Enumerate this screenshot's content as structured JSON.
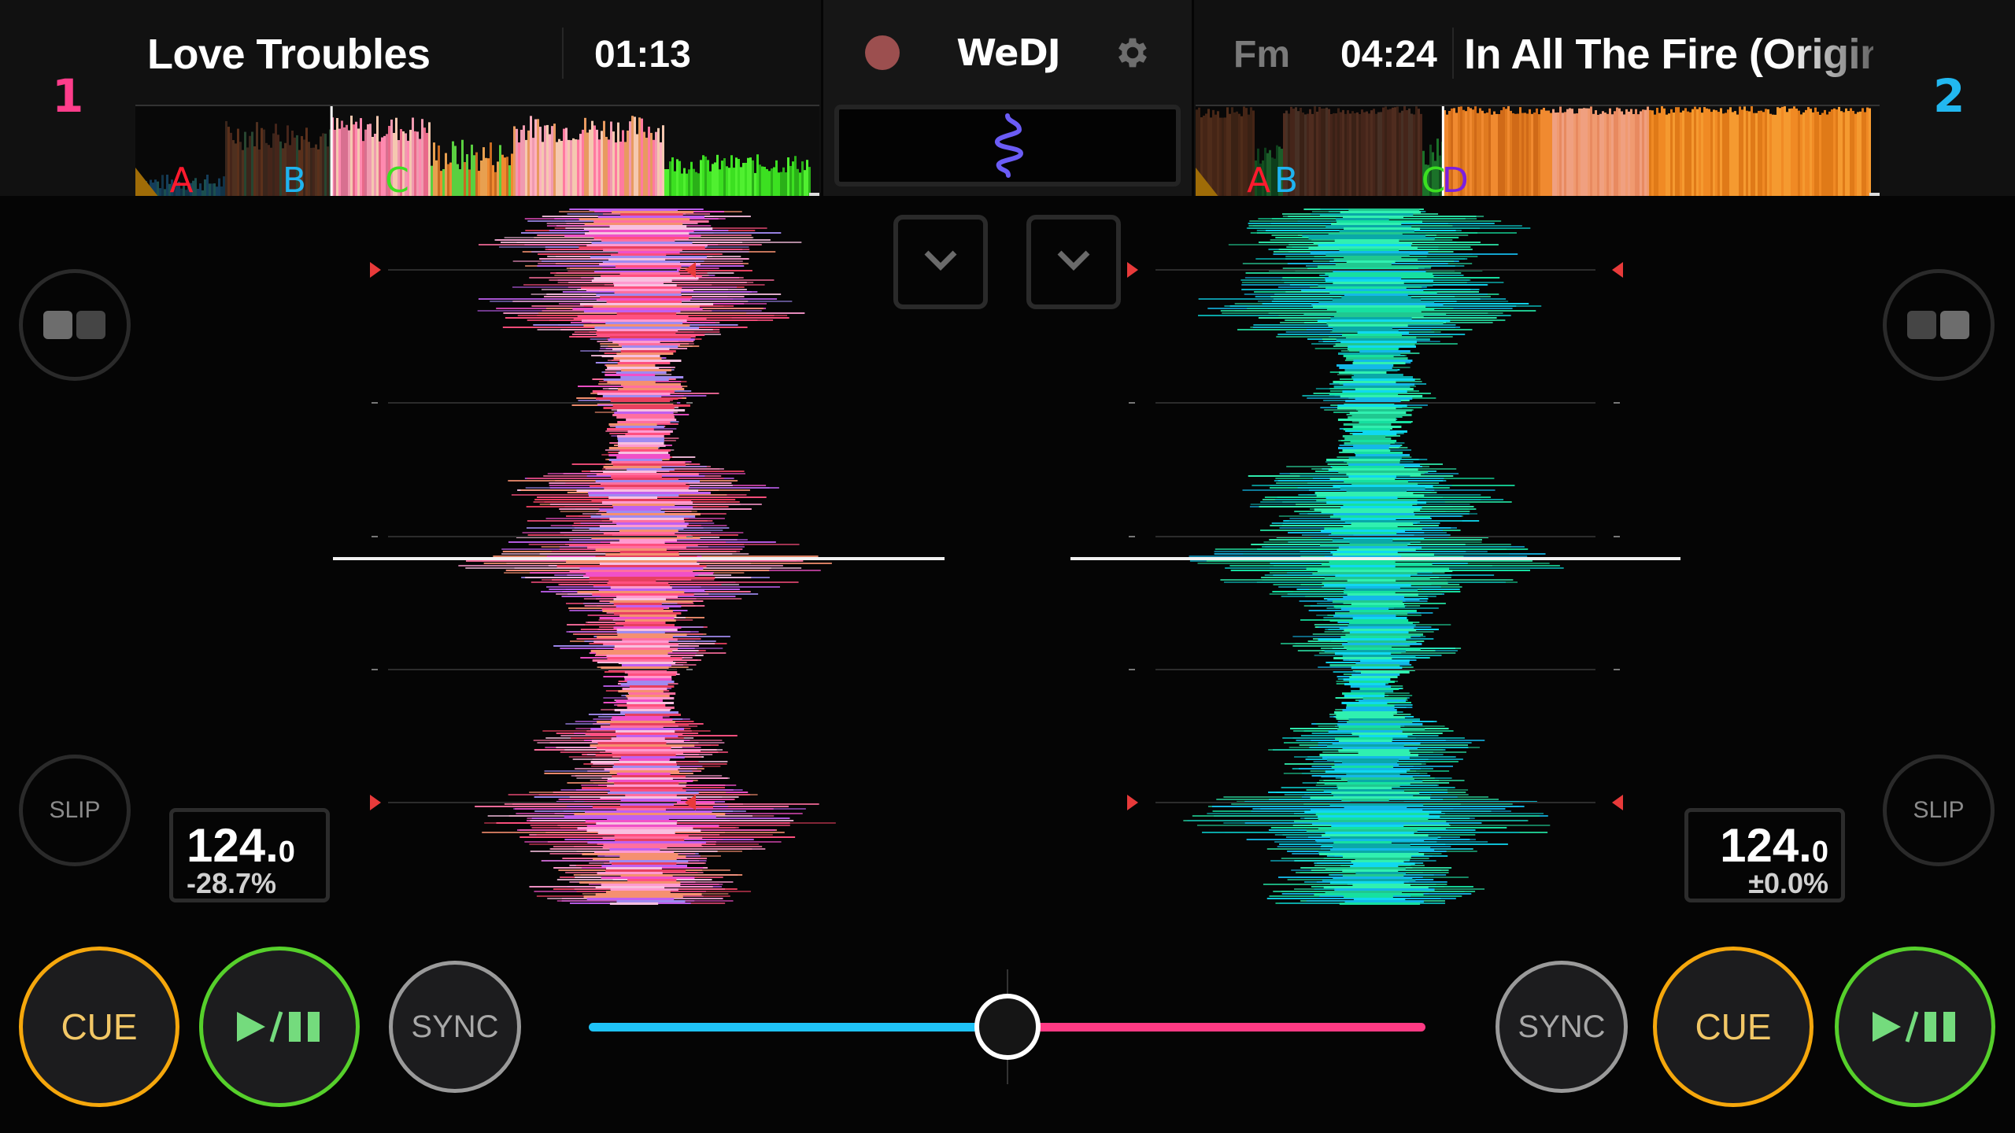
{
  "app": {
    "name": "WeDJ",
    "record_button": {
      "state": "off",
      "color": "#9c4f4f"
    },
    "settings_icon": "gear-icon",
    "fx_pad_icon": "waveform-squiggle-icon"
  },
  "colors": {
    "deck1_accent": "#ff3d8b",
    "deck2_accent": "#22b8f0",
    "cue": "#f5a70c",
    "play": "#56d02b",
    "sync": "#9a9a9a",
    "marker": "#e83a3a"
  },
  "deck1": {
    "number": "1",
    "title": "Love Troubles",
    "time": "01:13",
    "bpm_int": "124.",
    "bpm_dec": "0",
    "pitch": "-28.7%",
    "playhead_position": 0.285,
    "hot_cues": [
      {
        "label": "A",
        "position": 0.05,
        "color": "#ff1a2e"
      },
      {
        "label": "B",
        "position": 0.215,
        "color": "#1fb4f0"
      },
      {
        "label": "C",
        "position": 0.365,
        "color": "#3ce021"
      }
    ],
    "view_toggle_icon": "split-view-icon",
    "slip_label": "SLIP",
    "cue_label": "CUE",
    "play_label": "▶/❚❚",
    "sync_label": "SYNC",
    "zoom_button_icon": "chevron-down-icon"
  },
  "deck2": {
    "number": "2",
    "key": "Fm",
    "time": "04:24",
    "title": "In All The Fire (Original Mix)",
    "bpm_int": "124.",
    "bpm_dec": "0",
    "pitch": "±0.0%",
    "playhead_position": 0.36,
    "hot_cues": [
      {
        "label": "A",
        "position": 0.075,
        "color": "#ff1a2e"
      },
      {
        "label": "B",
        "position": 0.115,
        "color": "#1fb4f0"
      },
      {
        "label": "C",
        "position": 0.33,
        "color": "#3ce021"
      },
      {
        "label": "D",
        "position": 0.36,
        "color": "#7a1fe0"
      }
    ],
    "view_toggle_icon": "split-view-icon",
    "slip_label": "SLIP",
    "cue_label": "CUE",
    "play_label": "▶/❚❚",
    "sync_label": "SYNC",
    "zoom_button_icon": "chevron-down-icon"
  },
  "crossfader": {
    "position": 0.5
  }
}
